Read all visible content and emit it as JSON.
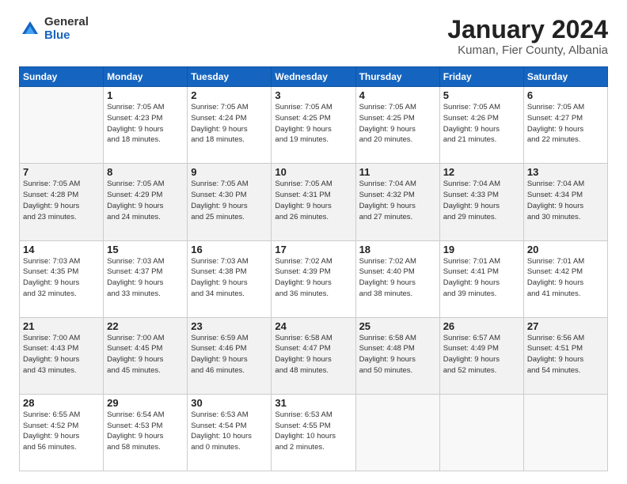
{
  "logo": {
    "general": "General",
    "blue": "Blue"
  },
  "title": {
    "month": "January 2024",
    "location": "Kuman, Fier County, Albania"
  },
  "weekdays": [
    "Sunday",
    "Monday",
    "Tuesday",
    "Wednesday",
    "Thursday",
    "Friday",
    "Saturday"
  ],
  "weeks": [
    [
      {
        "day": "",
        "info": ""
      },
      {
        "day": "1",
        "info": "Sunrise: 7:05 AM\nSunset: 4:23 PM\nDaylight: 9 hours\nand 18 minutes."
      },
      {
        "day": "2",
        "info": "Sunrise: 7:05 AM\nSunset: 4:24 PM\nDaylight: 9 hours\nand 18 minutes."
      },
      {
        "day": "3",
        "info": "Sunrise: 7:05 AM\nSunset: 4:25 PM\nDaylight: 9 hours\nand 19 minutes."
      },
      {
        "day": "4",
        "info": "Sunrise: 7:05 AM\nSunset: 4:25 PM\nDaylight: 9 hours\nand 20 minutes."
      },
      {
        "day": "5",
        "info": "Sunrise: 7:05 AM\nSunset: 4:26 PM\nDaylight: 9 hours\nand 21 minutes."
      },
      {
        "day": "6",
        "info": "Sunrise: 7:05 AM\nSunset: 4:27 PM\nDaylight: 9 hours\nand 22 minutes."
      }
    ],
    [
      {
        "day": "7",
        "info": "Sunrise: 7:05 AM\nSunset: 4:28 PM\nDaylight: 9 hours\nand 23 minutes."
      },
      {
        "day": "8",
        "info": "Sunrise: 7:05 AM\nSunset: 4:29 PM\nDaylight: 9 hours\nand 24 minutes."
      },
      {
        "day": "9",
        "info": "Sunrise: 7:05 AM\nSunset: 4:30 PM\nDaylight: 9 hours\nand 25 minutes."
      },
      {
        "day": "10",
        "info": "Sunrise: 7:05 AM\nSunset: 4:31 PM\nDaylight: 9 hours\nand 26 minutes."
      },
      {
        "day": "11",
        "info": "Sunrise: 7:04 AM\nSunset: 4:32 PM\nDaylight: 9 hours\nand 27 minutes."
      },
      {
        "day": "12",
        "info": "Sunrise: 7:04 AM\nSunset: 4:33 PM\nDaylight: 9 hours\nand 29 minutes."
      },
      {
        "day": "13",
        "info": "Sunrise: 7:04 AM\nSunset: 4:34 PM\nDaylight: 9 hours\nand 30 minutes."
      }
    ],
    [
      {
        "day": "14",
        "info": "Sunrise: 7:03 AM\nSunset: 4:35 PM\nDaylight: 9 hours\nand 32 minutes."
      },
      {
        "day": "15",
        "info": "Sunrise: 7:03 AM\nSunset: 4:37 PM\nDaylight: 9 hours\nand 33 minutes."
      },
      {
        "day": "16",
        "info": "Sunrise: 7:03 AM\nSunset: 4:38 PM\nDaylight: 9 hours\nand 34 minutes."
      },
      {
        "day": "17",
        "info": "Sunrise: 7:02 AM\nSunset: 4:39 PM\nDaylight: 9 hours\nand 36 minutes."
      },
      {
        "day": "18",
        "info": "Sunrise: 7:02 AM\nSunset: 4:40 PM\nDaylight: 9 hours\nand 38 minutes."
      },
      {
        "day": "19",
        "info": "Sunrise: 7:01 AM\nSunset: 4:41 PM\nDaylight: 9 hours\nand 39 minutes."
      },
      {
        "day": "20",
        "info": "Sunrise: 7:01 AM\nSunset: 4:42 PM\nDaylight: 9 hours\nand 41 minutes."
      }
    ],
    [
      {
        "day": "21",
        "info": "Sunrise: 7:00 AM\nSunset: 4:43 PM\nDaylight: 9 hours\nand 43 minutes."
      },
      {
        "day": "22",
        "info": "Sunrise: 7:00 AM\nSunset: 4:45 PM\nDaylight: 9 hours\nand 45 minutes."
      },
      {
        "day": "23",
        "info": "Sunrise: 6:59 AM\nSunset: 4:46 PM\nDaylight: 9 hours\nand 46 minutes."
      },
      {
        "day": "24",
        "info": "Sunrise: 6:58 AM\nSunset: 4:47 PM\nDaylight: 9 hours\nand 48 minutes."
      },
      {
        "day": "25",
        "info": "Sunrise: 6:58 AM\nSunset: 4:48 PM\nDaylight: 9 hours\nand 50 minutes."
      },
      {
        "day": "26",
        "info": "Sunrise: 6:57 AM\nSunset: 4:49 PM\nDaylight: 9 hours\nand 52 minutes."
      },
      {
        "day": "27",
        "info": "Sunrise: 6:56 AM\nSunset: 4:51 PM\nDaylight: 9 hours\nand 54 minutes."
      }
    ],
    [
      {
        "day": "28",
        "info": "Sunrise: 6:55 AM\nSunset: 4:52 PM\nDaylight: 9 hours\nand 56 minutes."
      },
      {
        "day": "29",
        "info": "Sunrise: 6:54 AM\nSunset: 4:53 PM\nDaylight: 9 hours\nand 58 minutes."
      },
      {
        "day": "30",
        "info": "Sunrise: 6:53 AM\nSunset: 4:54 PM\nDaylight: 10 hours\nand 0 minutes."
      },
      {
        "day": "31",
        "info": "Sunrise: 6:53 AM\nSunset: 4:55 PM\nDaylight: 10 hours\nand 2 minutes."
      },
      {
        "day": "",
        "info": ""
      },
      {
        "day": "",
        "info": ""
      },
      {
        "day": "",
        "info": ""
      }
    ]
  ]
}
